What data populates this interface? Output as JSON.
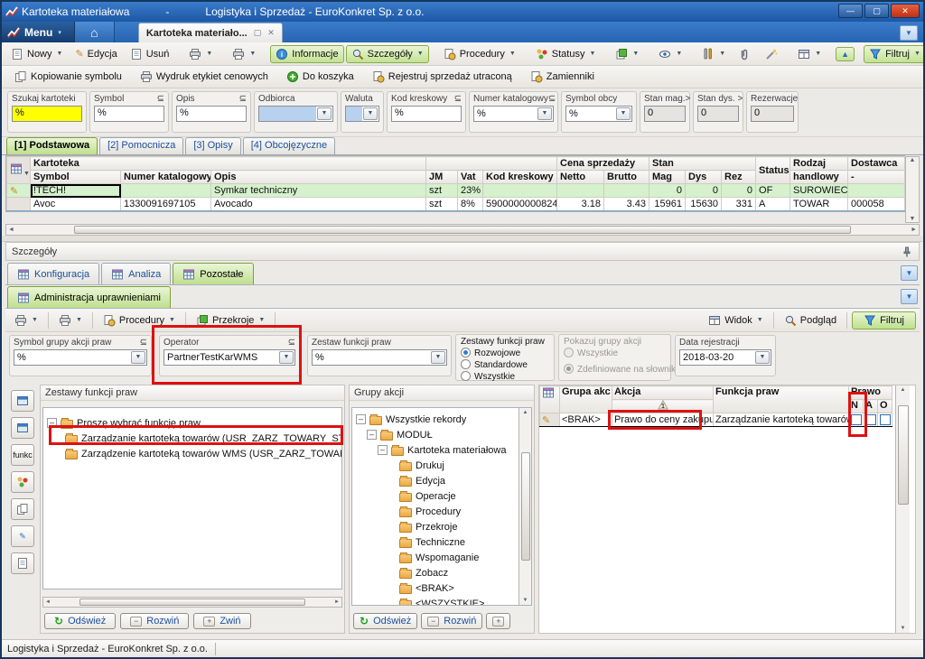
{
  "colors": {
    "accent_green": "#bfe08e",
    "annotation_red": "#dd1111",
    "selected_row": "#d5f1cd",
    "title_blue": "#1c57a4",
    "input_yellow": "#ffff00",
    "combo_blue": "#b8d1ee"
  },
  "titlebar": {
    "app": "Kartoteka materiałowa",
    "sep": "-",
    "company": "Logistyka i Sprzedaż - EuroKonkret Sp. z o.o."
  },
  "tabstrip": {
    "menu": "Menu",
    "doc_tab": "Kartoteka materiało..."
  },
  "toolbar1": {
    "nowy": "Nowy",
    "edycja": "Edycja",
    "usun": "Usuń",
    "informacje": "Informacje",
    "szczegoly": "Szczegóły",
    "procedury": "Procedury",
    "statusy": "Statusy",
    "filtruj": "Filtruj"
  },
  "toolbar2": {
    "kopiowanie": "Kopiowanie symbolu",
    "wydruk": "Wydruk etykiet cenowych",
    "koszyk": "Do koszyka",
    "rejestruj": "Rejestruj sprzedaż utraconą",
    "zamienniki": "Zamienniki"
  },
  "filters": {
    "szukaj": {
      "label": "Szukaj kartoteki",
      "value": "%"
    },
    "symbol": {
      "label": "Symbol",
      "op": "⊆",
      "value": "%"
    },
    "opis": {
      "label": "Opis",
      "op": "⊆",
      "value": "%"
    },
    "odbiorca": {
      "label": "Odbiorca",
      "value": ""
    },
    "waluta": {
      "label": "Waluta",
      "value": ""
    },
    "kod": {
      "label": "Kod kreskowy",
      "op": "⊆",
      "value": "%"
    },
    "numer": {
      "label": "Numer katalogowy",
      "op": "⊆",
      "value": "%"
    },
    "obcy": {
      "label": "Symbol obcy",
      "value": "%"
    },
    "stanmag": {
      "label": "Stan mag.>",
      "value": "0"
    },
    "standys": {
      "label": "Stan dys. >",
      "value": "0"
    },
    "rezerwacje": {
      "label": "Rezerwacje",
      "value": "0"
    }
  },
  "pagetabs": {
    "t1": "[1] Podstawowa",
    "t2": "[2] Pomocnicza",
    "t3": "[3] Opisy",
    "t4": "[4] Obcojęzyczne"
  },
  "grid": {
    "g_kartoteka": "Kartoteka",
    "g_cena": "Cena sprzedaży",
    "g_stan": "Stan",
    "g_status": "Status",
    "g_rodzaj": "Rodzaj",
    "g_dostawca": "Dostawca",
    "c_symbol": "Symbol",
    "c_numer": "Numer katalogowy",
    "c_opis": "Opis",
    "c_jm": "JM",
    "c_vat": "Vat",
    "c_kod": "Kod kreskowy",
    "c_netto": "Netto",
    "c_brutto": "Brutto",
    "c_mag": "Mag",
    "c_dys": "Dys",
    "c_rez": "Rez",
    "c_handlowy": "handlowy",
    "c_dash": "-",
    "rows": [
      {
        "symbol": "!TECH!",
        "numer": "",
        "opis": "Symkar techniczny",
        "jm": "szt",
        "vat": "23%",
        "kod": "",
        "netto": "",
        "brutto": "",
        "mag": "0",
        "dys": "0",
        "rez": "0",
        "status": "OF",
        "rodzaj": "SUROWIEC",
        "dostawca": ""
      },
      {
        "symbol": "Avoc",
        "numer": "1330091697105",
        "opis": "Avocado",
        "jm": "szt",
        "vat": "8%",
        "kod": "5900000000824",
        "netto": "3.18",
        "brutto": "3.43",
        "mag": "15961",
        "dys": "15630",
        "rez": "331",
        "status": "A",
        "rodzaj": "TOWAR",
        "dostawca": "000058"
      }
    ]
  },
  "details": {
    "title": "Szczegóły",
    "tab_konfiguracja": "Konfiguracja",
    "tab_analiza": "Analiza",
    "tab_pozostale": "Pozostałe",
    "subtab": "Administracja uprawnieniami",
    "tb": {
      "procedury": "Procedury",
      "przekroje": "Przekroje",
      "widok": "Widok",
      "podglad": "Podgląd",
      "filtruj": "Filtruj"
    },
    "f_symbol_grupy": {
      "label": "Symbol grupy akcji praw",
      "op": "⊆",
      "value": "%"
    },
    "f_operator": {
      "label": "Operator",
      "op": "⊆",
      "value": "PartnerTestKarWMS"
    },
    "f_zestaw": {
      "label": "Zestaw funkcji praw",
      "value": "%"
    },
    "f_zestawy": {
      "label": "Zestawy funkcji praw",
      "o1": "Rozwojowe",
      "o2": "Standardowe",
      "o3": "Wszystkie"
    },
    "f_pokazuj": {
      "label": "Pokazuj grupy akcji",
      "o1": "Wszystkie",
      "o2": "Zdefiniowane na słownik"
    },
    "f_data": {
      "label": "Data rejestracji",
      "value": "2018-03-20"
    },
    "sidebar_funkc": "funkc",
    "left_tree": {
      "title": "Zestawy funkcji praw",
      "root": "Proszę wybrać funkcję praw",
      "item1": "Zarządzanie kartoteką towarów (USR_ZARZ_TOWARY_STAR",
      "item2": "Zarządzenie kartoteką towarów WMS (USR_ZARZ_TOWARY_",
      "odswiez": "Odśwież",
      "rozwin": "Rozwiń",
      "zwin": "Zwiń"
    },
    "mid_tree": {
      "title": "Grupy akcji",
      "root": "Wszystkie rekordy",
      "n1": "MODUŁ",
      "n2": "Kartoteka materiałowa",
      "children": [
        "Drukuj",
        "Edycja",
        "Operacje",
        "Procedury",
        "Przekroje",
        "Techniczne",
        "Wspomaganie",
        "Zobacz",
        "<BRAK>",
        "<WSZYSTKIE>"
      ],
      "odswiez": "Odśwież",
      "rozwin": "Rozwiń",
      "plus": "+"
    },
    "rgrid": {
      "c_grupa": "Grupa akc",
      "c_akcja": "Akcja",
      "c_funkcja": "Funkcja praw",
      "c_prawo": "Prawo",
      "c_n": "N",
      "c_a": "A",
      "c_o": "O",
      "row": {
        "grupa": "<BRAK>",
        "akcja": "Prawo do ceny zakupu",
        "funkcja": "Zarządzanie kartoteką towarów"
      }
    }
  },
  "statusbar": {
    "text": "Logistyka i Sprzedaż - EuroKonkret Sp. z o.o."
  },
  "icons": [
    "chart-icon",
    "home-icon",
    "new-icon",
    "edit-icon",
    "delete-icon",
    "printer-icon",
    "info-icon",
    "magnifier-icon",
    "gear-icon",
    "status-dots-icon",
    "layers-icon",
    "eye-icon",
    "tools-icon",
    "paperclip-icon",
    "wand-icon",
    "layout-icon",
    "collapse-arrow-icon",
    "funnel-icon",
    "copy-icon",
    "cart-icon",
    "lost-sale-icon",
    "replacement-icon",
    "pin-icon",
    "table-icon",
    "folder-icon",
    "pencil-icon",
    "refresh-icon",
    "sort-1-icon",
    "checkbox"
  ]
}
